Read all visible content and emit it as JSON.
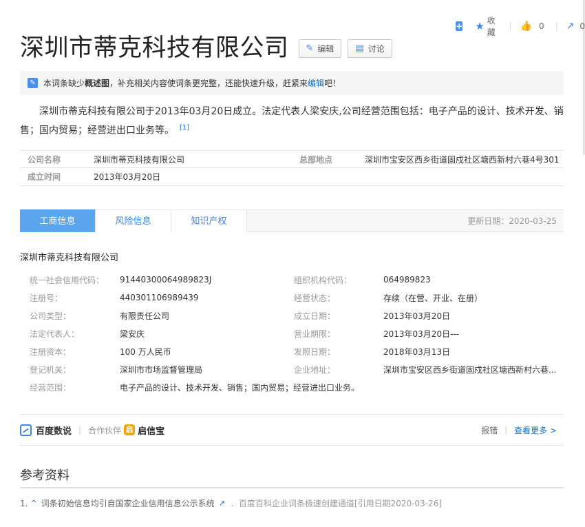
{
  "toolbar": {
    "add_symbol": "+",
    "favorite_label": "收藏",
    "like_count": "0",
    "share_count": "0"
  },
  "title": "深圳市蒂克科技有限公司",
  "buttons": {
    "edit": "编辑",
    "discuss": "讨论"
  },
  "notice": {
    "prefix": "本词条缺少",
    "missing": "概述图",
    "middle": "，补充相关内容使词条更完整，还能快速升级，赶紧来",
    "link": "编辑",
    "suffix": "吧！"
  },
  "summary": {
    "text": "深圳市蒂克科技有限公司于2013年03月20日成立。法定代表人梁安庆,公司经营范围包括：电子产品的设计、技术开发、销售；国内贸易；经营进出口业务等。",
    "ref": "[1]"
  },
  "basic_info": {
    "name_label": "公司名称",
    "name_value": "深圳市蒂克科技有限公司",
    "hq_label": "总部地点",
    "hq_value": "深圳市宝安区西乡街道固戍社区塘西新村六巷4号301",
    "founded_label": "成立时间",
    "founded_value": "2013年03月20日"
  },
  "tabs": [
    {
      "label": "工商信息"
    },
    {
      "label": "风险信息"
    },
    {
      "label": "知识产权"
    }
  ],
  "update_date": "更新日期：2020-03-25",
  "company_name": "深圳市蒂克科技有限公司",
  "details": [
    {
      "l1": "统一社会信用代码：",
      "v1": "91440300064989823J",
      "l2": "组织机构代码：",
      "v2": "064989823"
    },
    {
      "l1": "注册号：",
      "v1": "440301106989439",
      "l2": "经营状态：",
      "v2": "存续（在营、开业、在册）"
    },
    {
      "l1": "公司类型：",
      "v1": "有限责任公司",
      "l2": "成立日期：",
      "v2": "2013年03月20日"
    },
    {
      "l1": "法定代表人：",
      "v1": "梁安庆",
      "l2": "营业期限：",
      "v2": "2013年03月20日---"
    },
    {
      "l1": "注册资本：",
      "v1": "100 万人民币",
      "l2": "发照日期：",
      "v2": "2018年03月13日"
    },
    {
      "l1": "登记机关：",
      "v1": "深圳市市场监督管理局",
      "l2": "企业地址：",
      "v2": "深圳市宝安区西乡街道固戍社区塘西新村六巷..."
    }
  ],
  "scope": {
    "label": "经营范围：",
    "value": "电子产品的设计、技术开发、销售；国内贸易；经营进出口业务。"
  },
  "source": {
    "baidu": "百度数说",
    "sep": "|",
    "partner": "合作伙伴",
    "qixin_glyph": "启",
    "qixin": "启信宝",
    "report": "报错",
    "more": "查看更多 >"
  },
  "references": {
    "title": "参考资料",
    "num": "1.",
    "up": "^",
    "item": "词条初始信息均引自国家企业信用信息公示系统",
    "ext": "↗",
    "meta": "．百度百科企业词条极速创建通道[引用日期2020-03-26]"
  }
}
